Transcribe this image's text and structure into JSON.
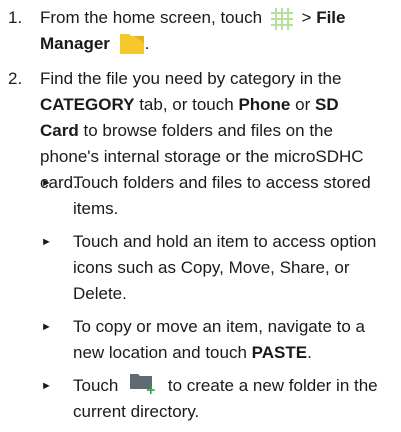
{
  "steps": [
    {
      "num": "1.",
      "prefix": "From the home screen, touch",
      "sep": ">",
      "bold1": "File",
      "bold2": "Manager",
      "end": "."
    },
    {
      "num": "2.",
      "t1": "Find the file you need by category in the",
      "b1": "CATEGORY",
      "t2": "tab, or touch",
      "b2": "Phone",
      "t3": "or",
      "b3": "SD",
      "b4": "Card",
      "t4": "to browse folders and files on the phone's internal storage or the microSDHC card."
    }
  ],
  "bullets": [
    {
      "text": "Touch folders and files to access stored items."
    },
    {
      "text": "Touch and hold an item to access option icons such as Copy, Move, Share, or Delete."
    },
    {
      "pre": "To copy or move an item, navigate to a new location and touch",
      "bold": "PASTE",
      "post": "."
    },
    {
      "pre": "Touch",
      "post": "to create a new folder in the current directory."
    }
  ],
  "icons": {
    "apps": "apps-grid-icon",
    "file_manager": "file-manager-folder-icon",
    "new_folder": "new-folder-icon"
  },
  "colors": {
    "apps_grid": "#b6e09a",
    "folder": "#f5c92b",
    "new_folder": "#5f6b73"
  }
}
